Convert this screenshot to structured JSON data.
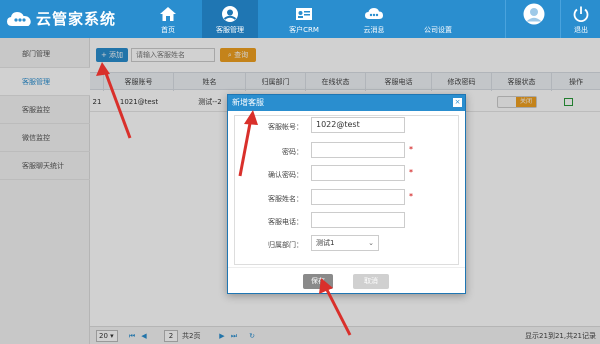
{
  "app": {
    "title": "云管家系统"
  },
  "nav": [
    {
      "label": "首页",
      "icon": "home-icon"
    },
    {
      "label": "客服管理",
      "icon": "service-icon"
    },
    {
      "label": "客户CRM",
      "icon": "crm-icon"
    },
    {
      "label": "云消息",
      "icon": "cloud-message-icon"
    },
    {
      "label": "公司设置",
      "icon": "settings-icon"
    }
  ],
  "user": {
    "logout_label": "退出"
  },
  "sidebar": {
    "items": [
      {
        "label": "部门管理"
      },
      {
        "label": "客服管理"
      },
      {
        "label": "客服监控"
      },
      {
        "label": "微信监控"
      },
      {
        "label": "客服聊天统计"
      }
    ]
  },
  "toolbar": {
    "add_label": "+ 添加",
    "search_placeholder": "请输入客服姓名",
    "search_label": "查询"
  },
  "table": {
    "columns": [
      "客服账号",
      "姓名",
      "归属部门",
      "在线状态",
      "客服电话",
      "修改密码",
      "客服状态",
      "操作"
    ],
    "row": {
      "id": "21",
      "account": "1021@test",
      "name": "测试--2",
      "status_label": "关闭"
    }
  },
  "pager": {
    "page_size": "20",
    "current_page": "2",
    "total_pages": "共2页",
    "info": "显示21到21,共21记录"
  },
  "dialog": {
    "title": "新增客服",
    "close": "×",
    "fields": {
      "account_label": "客服帐号：",
      "account_value": "1022@test",
      "password_label": "密码：",
      "confirm_label": "确认密码：",
      "name_label": "客服姓名：",
      "phone_label": "客服电话：",
      "dept_label": "归属部门：",
      "dept_value": "测试1",
      "required_mark": "*"
    },
    "save_label": "保存",
    "cancel_label": "取消"
  },
  "colors": {
    "primary": "#2a8ecf",
    "header_active": "#1f76b3",
    "search_button": "#f0a020",
    "annotation": "#d9302b"
  }
}
